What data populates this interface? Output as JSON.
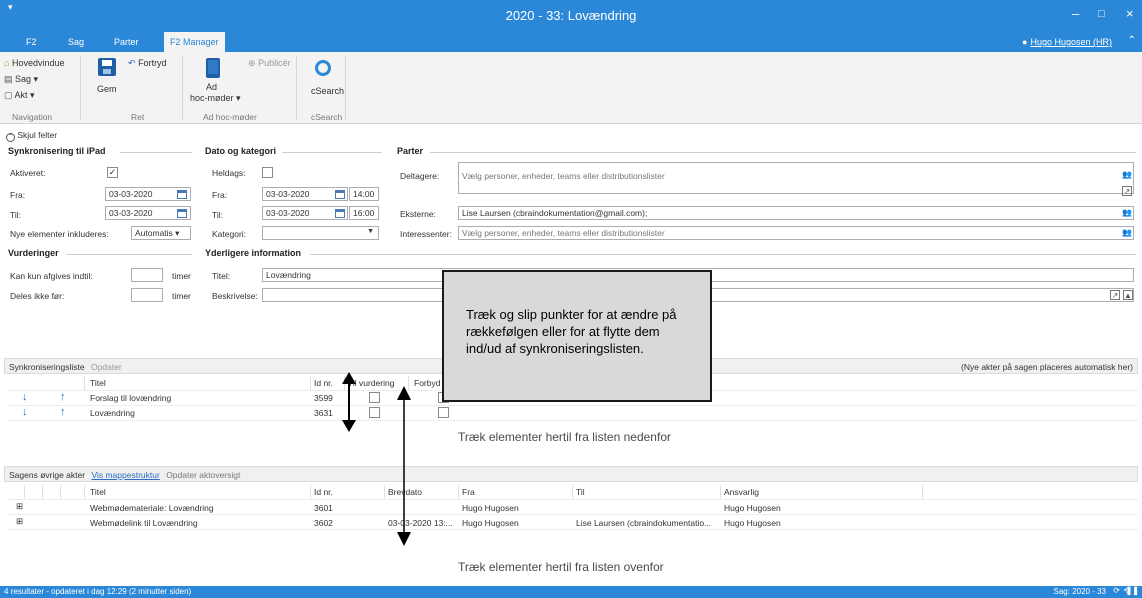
{
  "window": {
    "title": "2020 - 33: Lovændring",
    "quick_access": "▾",
    "minimize": "–",
    "maximize": "□",
    "close": "×"
  },
  "tabs": [
    "F2",
    "Sag",
    "Parter",
    "F2 Manager"
  ],
  "user": "Hugo Hugosen (HR)",
  "ribbon": {
    "hovedvindue": "Hovedvindue",
    "sag": "Sag ▾",
    "akt": "Akt ▾",
    "navigation": "Navigation",
    "gem": "Gem",
    "fortryd": "Fortryd",
    "ret": "Ret",
    "ad": "Ad",
    "hocmoder": "hoc-møder ▾",
    "publicer": "Publicér",
    "adhoc_group": "Ad hoc-møder",
    "csearch": "cSearch",
    "csearch_group": "cSearch"
  },
  "skjul_felter": "Skjul felter",
  "sync": {
    "title": "Synkronisering til iPad",
    "aktiveret_label": "Aktiveret:",
    "aktiveret_mark": "✓",
    "fra_label": "Fra:",
    "fra_value": "03-03-2020",
    "til_label": "Til:",
    "til_value": "03-03-2020",
    "nye_label": "Nye elementer inkluderes:",
    "nye_value": "Automatis ▾"
  },
  "dato": {
    "title": "Dato og kategori",
    "heldags_label": "Heldags:",
    "fra_label": "Fra:",
    "fra_date": "03-03-2020",
    "fra_time": "14:00",
    "til_label": "Til:",
    "til_date": "03-03-2020",
    "til_time": "16:00",
    "kategori_label": "Kategori:",
    "kategori_arrow": "▼"
  },
  "parter": {
    "title": "Parter",
    "deltagere_label": "Deltagere:",
    "deltagere_placeholder": "Vælg personer, enheder, teams eller distributionslister",
    "eksterne_label": "Eksterne:",
    "eksterne_value": "Lise Laursen (cbraindokumentation@gmail.com);",
    "interessenter_label": "Interessenter:",
    "interessenter_placeholder": "Vælg personer, enheder, teams eller distributionslister"
  },
  "vurderinger": {
    "title": "Vurderinger",
    "kan_label": "Kan kun afgives indtil:",
    "kan_unit": "timer",
    "deles_label": "Deles ikke før:",
    "deles_unit": "timer"
  },
  "yderligere": {
    "title": "Yderligere information",
    "titel_label": "Titel:",
    "titel_value": "Lovændring",
    "beskrivelse_label": "Beskrivelse:"
  },
  "synclist": {
    "header_title": "Synkroniseringsliste",
    "header_link": "Opdater",
    "header_note": "(Nye akter på sagen placeres automatisk her)",
    "columns": [
      "Titel",
      "Id nr.",
      "Til vurdering",
      "Forbyd"
    ],
    "rows": [
      {
        "title": "Forslag til lovændring",
        "id": "3599"
      },
      {
        "title": "Lovændring",
        "id": "3631"
      }
    ],
    "drop_text": "Træk elementer hertil fra listen nedenfor"
  },
  "other": {
    "header_title": "Sagens øvrige akter",
    "link1": "Vis mappestruktur",
    "link2": "Opdater aktoversigt",
    "columns": [
      "Titel",
      "Id nr.",
      "Brevdato",
      "Fra",
      "Til",
      "Ansvarlig"
    ],
    "rows": [
      {
        "expander": "⊞",
        "title": "Webmødemateriale: Lovændring",
        "id": "3601",
        "date": "",
        "fra": "Hugo Hugosen",
        "til": "",
        "ansvarlig": "Hugo Hugosen"
      },
      {
        "expander": "⊞",
        "title": "Webmødelink til Lovændring",
        "id": "3602",
        "date": "03-03-2020 13:...",
        "fra": "Hugo Hugosen",
        "til": "Lise Laursen (cbraindokumentatio...",
        "ansvarlig": "Hugo Hugosen"
      }
    ],
    "drop_text": "Træk elementer hertil fra listen ovenfor"
  },
  "callout": "Træk og slip punkter for at ændre på rækkefølgen eller for at flytte dem ind/ud af synkroniseringslisten.",
  "status": {
    "left": "4 resultater - opdateret i dag 12:29 (2 minutter siden)",
    "right": "Sag: 2020 - 33"
  },
  "colors": {
    "accent": "#2b88d8",
    "arrow_down": "#2b6cc4",
    "arrow_up": "#2b6cc4"
  }
}
